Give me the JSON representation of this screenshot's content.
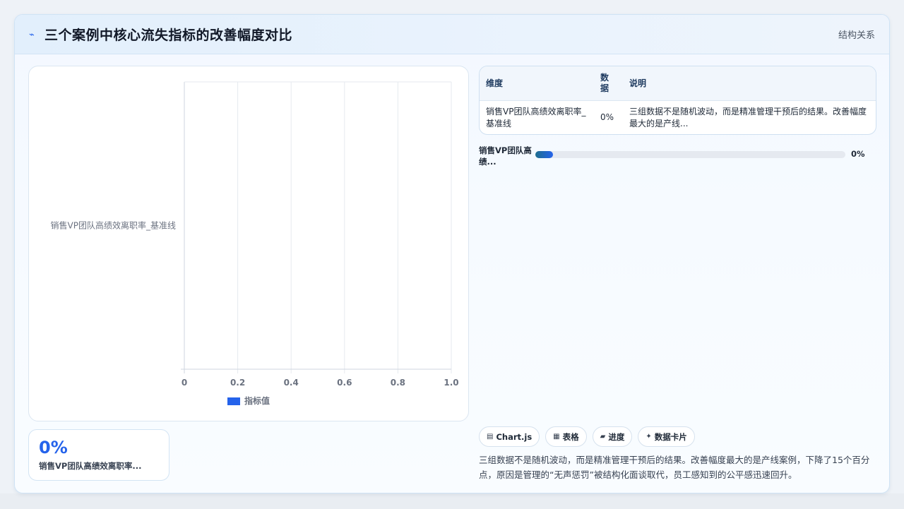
{
  "header": {
    "icon": "lightning-icon",
    "title": "三个案例中核心流失指标的改善幅度对比",
    "tag": "结构关系"
  },
  "chart_data": {
    "type": "bar",
    "orientation": "horizontal",
    "categories": [
      "销售VP团队高绩效离职率_基准线"
    ],
    "series": [
      {
        "name": "指标值",
        "values": [
          0
        ],
        "color": "#2563eb"
      }
    ],
    "x_ticks": [
      "0",
      "0.2",
      "0.4",
      "0.6",
      "0.8",
      "1.0"
    ],
    "xlim": [
      0,
      1
    ],
    "grid": true,
    "legend": "bottom"
  },
  "kpi": {
    "value": "0%",
    "label": "销售VP团队高绩效离职率..."
  },
  "table": {
    "headers": [
      "维度",
      "数据",
      "说明"
    ],
    "rows": [
      {
        "dimension": "销售VP团队高绩效离职率_基准线",
        "value": "0%",
        "note": "三组数据不是随机波动，而是精准管理干预后的结果。改善幅度最大的是产线..."
      }
    ]
  },
  "progress": {
    "label": "销售VP团队高绩...",
    "value_text": "0%",
    "value": 0
  },
  "tabs": [
    {
      "icon": "chart-icon",
      "glyph": "▤",
      "label": "Chart.js"
    },
    {
      "icon": "table-icon",
      "glyph": "▦",
      "label": "表格"
    },
    {
      "icon": "progress-icon",
      "glyph": "▰",
      "label": "进度"
    },
    {
      "icon": "card-icon",
      "glyph": "✦",
      "label": "数据卡片"
    }
  ],
  "summary": "三组数据不是随机波动，而是精准管理干预后的结果。改善幅度最大的是产线案例，下降了15个百分点，原因是管理的“无声惩罚”被结构化面谈取代，员工感知到的公平感迅速回升。"
}
